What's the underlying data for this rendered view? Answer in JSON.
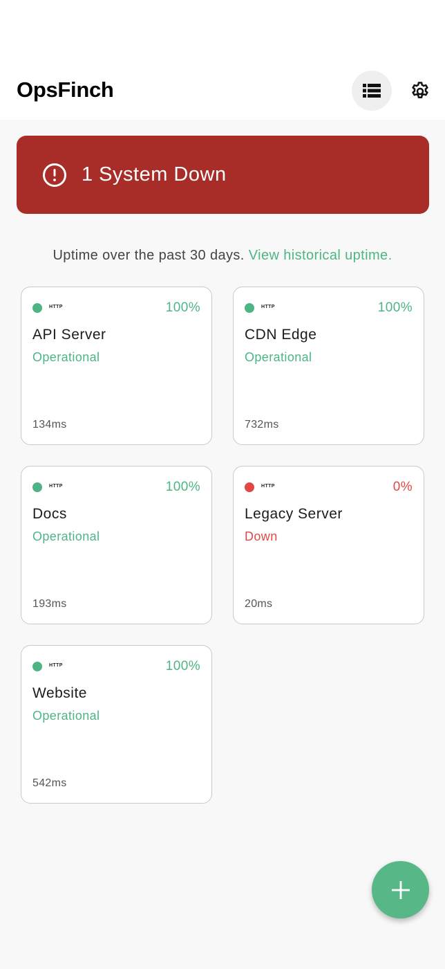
{
  "app": {
    "title": "OpsFinch"
  },
  "header": {
    "list_view_icon": "list-icon",
    "settings_icon": "gear-icon"
  },
  "alert": {
    "text": "1 System Down",
    "icon": "exclamation-circle-icon",
    "color": "#a82c27"
  },
  "uptime": {
    "prefix": "Uptime over the past 30 days.",
    "link": "View historical uptime."
  },
  "monitors": [
    {
      "protocol": "HTTP",
      "uptime": "100%",
      "name": "API Server",
      "status": "Operational",
      "response": "134ms",
      "state": "up"
    },
    {
      "protocol": "HTTP",
      "uptime": "100%",
      "name": "CDN Edge",
      "status": "Operational",
      "response": "732ms",
      "state": "up"
    },
    {
      "protocol": "HTTP",
      "uptime": "100%",
      "name": "Docs",
      "status": "Operational",
      "response": "193ms",
      "state": "up"
    },
    {
      "protocol": "HTTP",
      "uptime": "0%",
      "name": "Legacy Server",
      "status": "Down",
      "response": "20ms",
      "state": "down"
    },
    {
      "protocol": "HTTP",
      "uptime": "100%",
      "name": "Website",
      "status": "Operational",
      "response": "542ms",
      "state": "up"
    }
  ],
  "colors": {
    "up": "#4db584",
    "down": "#e04848",
    "fab": "#58b786"
  },
  "fab": {
    "icon": "plus-icon"
  }
}
